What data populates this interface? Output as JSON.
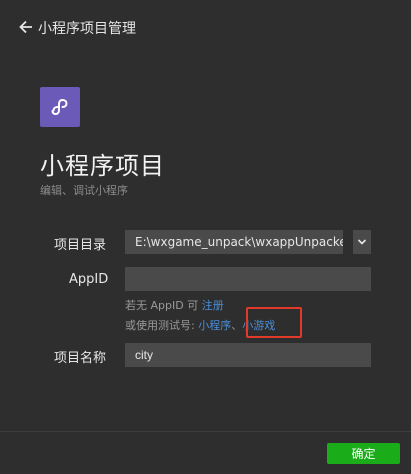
{
  "header": {
    "back_icon": "arrow-left-icon",
    "title": "小程序项目管理"
  },
  "logo": {
    "icon": "link-s-icon",
    "color": "#6b5ab8"
  },
  "main": {
    "title": "小程序项目",
    "subtitle": "编辑、调试小程序"
  },
  "form": {
    "project_dir": {
      "label": "项目目录",
      "value": "E:\\wxgame_unpack\\wxappUnpacker-",
      "dropdown_icon": "chevron-down-icon"
    },
    "appid": {
      "label": "AppID",
      "value": ""
    },
    "hints": {
      "line1_prefix": "若无 AppID 可",
      "line1_link": "注册",
      "line2_prefix": "或使用测试号:",
      "line2_link1": "小程序",
      "line2_sep": "、",
      "line2_link2": "小游戏"
    },
    "project_name": {
      "label": "项目名称",
      "value": "city"
    }
  },
  "footer": {
    "confirm_label": "确定"
  },
  "colors": {
    "background": "#2e2e2e",
    "field": "#4a4a4a",
    "link": "#4a8ed6",
    "confirm": "#1aad19",
    "highlight": "#e23a2a"
  }
}
